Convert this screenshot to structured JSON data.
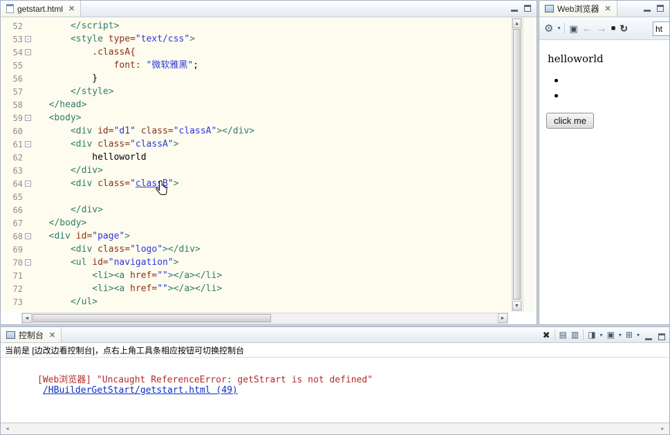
{
  "glyphs": {
    "close": "✕",
    "gear": "⚙",
    "dropdown": "▾",
    "devtools": "▣",
    "back": "←",
    "forward": "→",
    "stop": "■",
    "refresh": "↻",
    "up_arrow": "▲",
    "down_arrow": "▼",
    "left_arrow": "◄",
    "right_arrow": "►"
  },
  "colors": {
    "editor_background": "#FEFCEE",
    "tag": "#2D7A68",
    "attribute": "#8A2F17",
    "value": "#2B36D9",
    "error_text": "#B22B27",
    "link": "#0B2EC4"
  },
  "editor": {
    "tab_label": "getstart.html",
    "lines": [
      {
        "n": 52,
        "f": false,
        "s": [
          [
            "p",
            "      "
          ],
          [
            "t",
            "</script>"
          ]
        ]
      },
      {
        "n": 53,
        "f": true,
        "s": [
          [
            "p",
            "      "
          ],
          [
            "t",
            "<style "
          ],
          [
            "a",
            "type="
          ],
          [
            "v",
            "\"text/css\""
          ],
          [
            "t",
            ">"
          ]
        ]
      },
      {
        "n": 54,
        "f": true,
        "s": [
          [
            "p",
            "          "
          ],
          [
            "a",
            ".classA{"
          ]
        ]
      },
      {
        "n": 55,
        "f": false,
        "s": [
          [
            "p",
            "              "
          ],
          [
            "a",
            "font: "
          ],
          [
            "v",
            "\"微软雅黑\""
          ],
          [
            "p",
            ";"
          ]
        ]
      },
      {
        "n": 56,
        "f": false,
        "s": [
          [
            "p",
            "          }"
          ]
        ]
      },
      {
        "n": 57,
        "f": false,
        "s": [
          [
            "p",
            "      "
          ],
          [
            "t",
            "</style>"
          ]
        ]
      },
      {
        "n": 58,
        "f": false,
        "s": [
          [
            "p",
            "  "
          ],
          [
            "t",
            "</head>"
          ]
        ]
      },
      {
        "n": 59,
        "f": true,
        "s": [
          [
            "p",
            "  "
          ],
          [
            "t",
            "<body>"
          ]
        ]
      },
      {
        "n": 60,
        "f": false,
        "s": [
          [
            "p",
            "      "
          ],
          [
            "t",
            "<div "
          ],
          [
            "a",
            "id="
          ],
          [
            "v",
            "\"d1\""
          ],
          [
            "p",
            " "
          ],
          [
            "a",
            "class="
          ],
          [
            "v",
            "\"classA\""
          ],
          [
            "t",
            "></div>"
          ]
        ]
      },
      {
        "n": 61,
        "f": true,
        "s": [
          [
            "p",
            "      "
          ],
          [
            "t",
            "<div "
          ],
          [
            "a",
            "class="
          ],
          [
            "v",
            "\"classA\""
          ],
          [
            "t",
            ">"
          ]
        ]
      },
      {
        "n": 62,
        "f": false,
        "s": [
          [
            "p",
            "          helloworld"
          ]
        ]
      },
      {
        "n": 63,
        "f": false,
        "s": [
          [
            "p",
            "      "
          ],
          [
            "t",
            "</div>"
          ]
        ]
      },
      {
        "n": 64,
        "f": true,
        "s": [
          [
            "p",
            "      "
          ],
          [
            "t",
            "<div "
          ],
          [
            "a",
            "class="
          ],
          [
            "v",
            "\""
          ],
          [
            "u",
            "classB"
          ],
          [
            "v",
            "\""
          ],
          [
            "t",
            ">"
          ]
        ]
      },
      {
        "n": 65,
        "f": false,
        "s": []
      },
      {
        "n": 66,
        "f": false,
        "s": [
          [
            "p",
            "      "
          ],
          [
            "t",
            "</div>"
          ]
        ]
      },
      {
        "n": 67,
        "f": false,
        "s": [
          [
            "p",
            "  "
          ],
          [
            "t",
            "</body>"
          ]
        ]
      },
      {
        "n": 68,
        "f": true,
        "s": [
          [
            "p",
            "  "
          ],
          [
            "t",
            "<div "
          ],
          [
            "a",
            "id="
          ],
          [
            "v",
            "\"page\""
          ],
          [
            "t",
            ">"
          ]
        ]
      },
      {
        "n": 69,
        "f": false,
        "s": [
          [
            "p",
            "      "
          ],
          [
            "t",
            "<div "
          ],
          [
            "a",
            "class="
          ],
          [
            "v",
            "\"logo\""
          ],
          [
            "t",
            "></div>"
          ]
        ]
      },
      {
        "n": 70,
        "f": true,
        "s": [
          [
            "p",
            "      "
          ],
          [
            "t",
            "<ul "
          ],
          [
            "a",
            "id="
          ],
          [
            "v",
            "\"navigation\""
          ],
          [
            "t",
            ">"
          ]
        ]
      },
      {
        "n": 71,
        "f": false,
        "s": [
          [
            "p",
            "          "
          ],
          [
            "t",
            "<li><a "
          ],
          [
            "a",
            "href="
          ],
          [
            "v",
            "\"\""
          ],
          [
            "t",
            "></a></li>"
          ]
        ]
      },
      {
        "n": 72,
        "f": false,
        "s": [
          [
            "p",
            "          "
          ],
          [
            "t",
            "<li><a "
          ],
          [
            "a",
            "href="
          ],
          [
            "v",
            "\"\""
          ],
          [
            "t",
            "></a></li>"
          ]
        ]
      },
      {
        "n": 73,
        "f": false,
        "s": [
          [
            "p",
            "      "
          ],
          [
            "t",
            "</ul>"
          ]
        ]
      }
    ]
  },
  "browser": {
    "tab_label": "Web浏览器",
    "url_value": "ht",
    "heading": "helloworld",
    "bullet_count": 2,
    "button_label": "click me"
  },
  "console": {
    "tab_label": "控制台",
    "info_text": "当前是 [边改边看控制台]，点右上角工具条相应按钮可切换控制台",
    "error_text": "[Web浏览器] \"Uncaught ReferenceError: getStrart is not defined\"",
    "link_text": "/HBuilderGetStart/getstart.html (49)",
    "toolbar": [
      {
        "name": "clear-console-icon",
        "glyph": "✖",
        "first": true,
        "sep": true
      },
      {
        "name": "save-log-icon",
        "glyph": "▤"
      },
      {
        "name": "open-log-icon",
        "glyph": "▥",
        "sep": true
      },
      {
        "name": "pin-console-icon",
        "glyph": "◨",
        "dropdown": true
      },
      {
        "name": "display-console-icon",
        "glyph": "▣",
        "dropdown": true
      },
      {
        "name": "open-console-icon",
        "glyph": "⊞",
        "dropdown": true
      }
    ]
  }
}
